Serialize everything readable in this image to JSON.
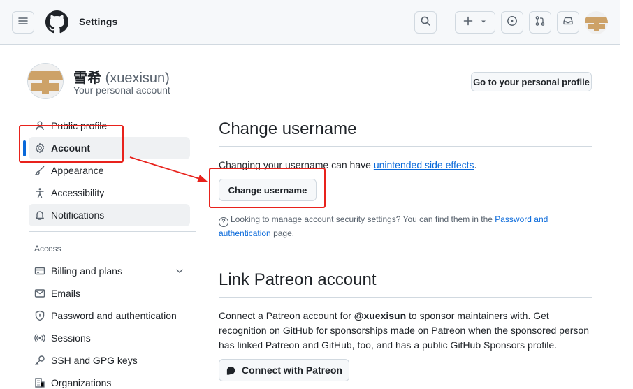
{
  "header": {
    "title": "Settings",
    "icons": [
      "menu-icon",
      "github-logo",
      "search-icon",
      "plus-icon",
      "chevron-down-icon",
      "issues-icon",
      "pull-request-icon",
      "inbox-icon"
    ]
  },
  "profile": {
    "display_name": "雪希",
    "login": "(xuexisun)",
    "subtitle": "Your personal account",
    "go_profile_button": "Go to your personal profile"
  },
  "sidebar": {
    "items": [
      {
        "label": "Public profile",
        "icon": "person-icon"
      },
      {
        "label": "Account",
        "icon": "gear-icon",
        "active": true
      },
      {
        "label": "Appearance",
        "icon": "paintbrush-icon"
      },
      {
        "label": "Accessibility",
        "icon": "accessibility-icon"
      },
      {
        "label": "Notifications",
        "icon": "bell-icon"
      }
    ],
    "access_heading": "Access",
    "access_items": [
      {
        "label": "Billing and plans",
        "icon": "credit-card-icon"
      },
      {
        "label": "Emails",
        "icon": "mail-icon"
      },
      {
        "label": "Password and authentication",
        "icon": "shield-icon"
      },
      {
        "label": "Sessions",
        "icon": "broadcast-icon"
      },
      {
        "label": "SSH and GPG keys",
        "icon": "key-icon"
      },
      {
        "label": "Organizations",
        "icon": "organization-icon"
      }
    ]
  },
  "change_username": {
    "heading": "Change username",
    "text_before": "Changing your username can have ",
    "link": "unintended side effects",
    "text_after": ".",
    "button": "Change username",
    "note_before": "Looking to manage account security settings? You can find them in the ",
    "note_link": "Password and authentication",
    "note_after": " page."
  },
  "patreon": {
    "heading": "Link Patreon account",
    "text_before": "Connect a Patreon account for ",
    "mention": "@xuexisun",
    "text_after": " to sponsor maintainers with. Get recognition on GitHub for sponsorships made on Patreon when the sponsored person has linked Patreon and GitHub, too, and has a public GitHub Sponsors profile.",
    "button": "Connect with Patreon"
  },
  "colors": {
    "accent": "#0969da",
    "annotation": "#e8221c",
    "avatar": "#cda268"
  }
}
